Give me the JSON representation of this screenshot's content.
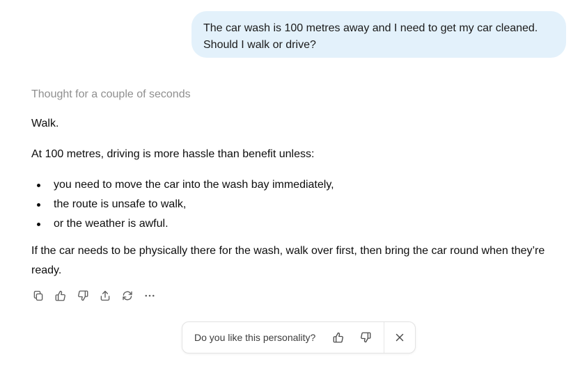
{
  "user_message": {
    "lines": [
      "The car wash is 100 metres away and I need to get my car cleaned.",
      "Should I walk or drive?"
    ]
  },
  "assistant": {
    "thought_label": "Thought for a couple of seconds",
    "answer_short": "Walk.",
    "intro": "At 100 metres, driving is more hassle than benefit unless:",
    "bullets": [
      "you need to move the car into the wash bay immediately,",
      "the route is unsafe to walk,",
      "or the weather is awful."
    ],
    "final": "If the car needs to be physically there for the wash, walk over first, then bring the car round when they’re ready."
  },
  "actions": [
    {
      "icon": "copy-icon"
    },
    {
      "icon": "thumbs-up-icon"
    },
    {
      "icon": "thumbs-down-icon"
    },
    {
      "icon": "share-icon"
    },
    {
      "icon": "regenerate-icon"
    },
    {
      "icon": "more-icon"
    }
  ],
  "feedback": {
    "question": "Do you like this personality?",
    "icons": [
      "thumbs-up-icon",
      "thumbs-down-icon",
      "close-icon"
    ]
  },
  "colors": {
    "user_bubble": "#e3f1fb",
    "thought_text": "#8f8f8f",
    "body_text": "#0d0d0d",
    "icon": "#5d5d5d"
  }
}
